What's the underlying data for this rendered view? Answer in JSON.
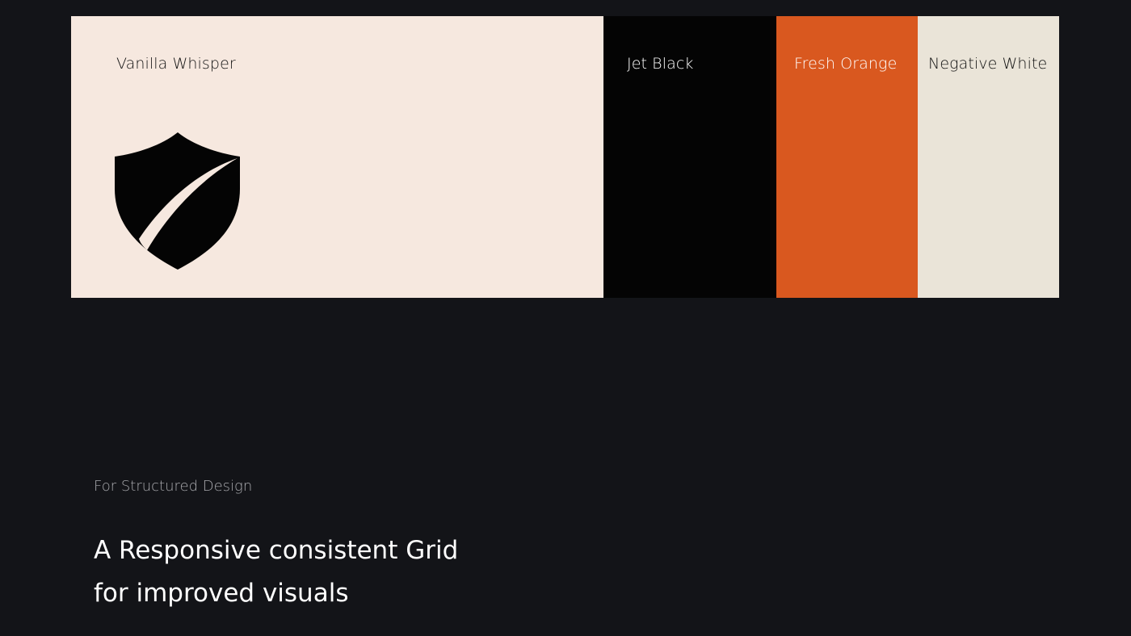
{
  "palette": {
    "swatches": [
      {
        "name": "Vanilla Whisper",
        "color": "#F6E8DF",
        "text_color": "#111111"
      },
      {
        "name": "Jet Black",
        "color": "#040404",
        "text_color": "#FFFFFF"
      },
      {
        "name": "Fresh Orange",
        "color": "#D9581F",
        "text_color": "#FFFFFF"
      },
      {
        "name": "Negative White",
        "color": "#EAE4D8",
        "text_color": "#111111"
      }
    ],
    "logo_icon": "shield-with-swoosh-icon"
  },
  "section": {
    "eyebrow": "For Structured Design",
    "headline_line1": "A Responsive consistent Grid",
    "headline_line2": "for improved visuals"
  },
  "colors": {
    "page_background": "#131418",
    "eyebrow_text": "#A8A9AD",
    "headline_text": "#FFFFFF"
  }
}
